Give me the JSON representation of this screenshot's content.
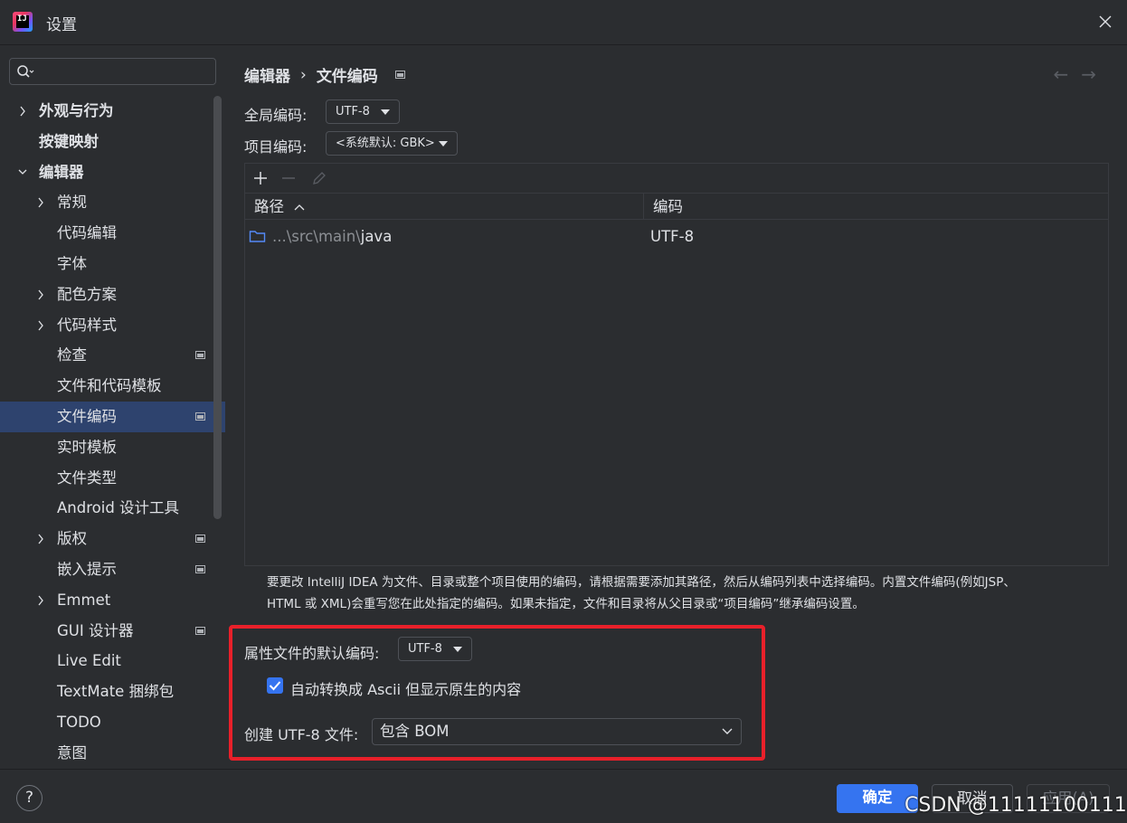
{
  "window": {
    "title": "设置",
    "app_logo_text": "IJ"
  },
  "sidebar": {
    "search_placeholder": "",
    "items": [
      {
        "label": "外观与行为",
        "level": 0,
        "expandable": true,
        "expanded": false,
        "bold": true
      },
      {
        "label": "按键映射",
        "level": 0,
        "expandable": false,
        "bold": true
      },
      {
        "label": "编辑器",
        "level": 0,
        "expandable": true,
        "expanded": true,
        "bold": true
      },
      {
        "label": "常规",
        "level": 1,
        "expandable": true,
        "expanded": false
      },
      {
        "label": "代码编辑",
        "level": 1
      },
      {
        "label": "字体",
        "level": 1
      },
      {
        "label": "配色方案",
        "level": 1,
        "expandable": true,
        "expanded": false
      },
      {
        "label": "代码样式",
        "level": 1,
        "expandable": true,
        "expanded": false
      },
      {
        "label": "检查",
        "level": 1,
        "marker": true
      },
      {
        "label": "文件和代码模板",
        "level": 1
      },
      {
        "label": "文件编码",
        "level": 1,
        "marker": true,
        "selected": true
      },
      {
        "label": "实时模板",
        "level": 1
      },
      {
        "label": "文件类型",
        "level": 1
      },
      {
        "label": "Android 设计工具",
        "level": 1
      },
      {
        "label": "版权",
        "level": 1,
        "expandable": true,
        "expanded": false,
        "marker": true
      },
      {
        "label": "嵌入提示",
        "level": 1,
        "marker": true
      },
      {
        "label": "Emmet",
        "level": 1,
        "expandable": true,
        "expanded": false
      },
      {
        "label": "GUI 设计器",
        "level": 1,
        "marker": true
      },
      {
        "label": "Live Edit",
        "level": 1
      },
      {
        "label": "TextMate 捆绑包",
        "level": 1
      },
      {
        "label": "TODO",
        "level": 1
      },
      {
        "label": "意图",
        "level": 1
      }
    ]
  },
  "breadcrumb": {
    "parent": "编辑器",
    "separator": "›",
    "current": "文件编码"
  },
  "global_encoding": {
    "label": "全局编码:",
    "value": "UTF-8"
  },
  "project_encoding": {
    "label": "项目编码:",
    "value": "<系统默认: GBK>"
  },
  "table": {
    "columns": [
      {
        "label": "路径",
        "sort": "ascending"
      },
      {
        "label": "编码"
      }
    ],
    "rows": [
      {
        "path_prefix": "...\\src\\main\\",
        "path_name": "java",
        "encoding": "UTF-8"
      }
    ]
  },
  "hint": {
    "line1": "要更改 IntelliJ IDEA 为文件、目录或整个项目使用的编码，请根据需要添加其路径，然后从编码列表中选择编码。内置文件编码(例如JSP、",
    "line2": "HTML 或 XML)会重写您在此处指定的编码。如果未指定，文件和目录将从父目录或“项目编码”继承编码设置。"
  },
  "properties": {
    "label": "属性文件的默认编码:",
    "value": "UTF-8",
    "checkbox_label": "自动转换成 Ascii 但显示原生的内容",
    "checkbox_checked": true
  },
  "bom": {
    "label": "创建 UTF-8 文件:",
    "value": "包含 BOM"
  },
  "footer": {
    "help": "?",
    "ok": "确定",
    "cancel": "取消",
    "apply": "应用(A)",
    "watermark": "CSDN @11111100111"
  },
  "colors": {
    "background": "#2b2d30",
    "selection": "#2e436e",
    "accent": "#3574f0",
    "highlight_box": "#e8202a",
    "folder_icon": "#548af7"
  }
}
